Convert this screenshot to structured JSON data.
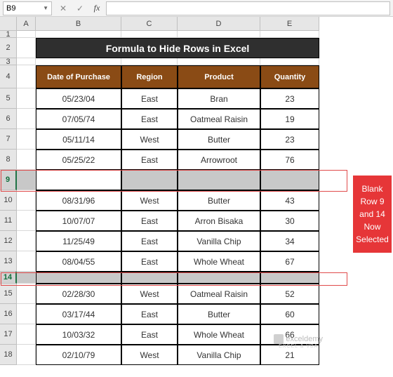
{
  "namebox": "B9",
  "columns": [
    "A",
    "B",
    "C",
    "D",
    "E"
  ],
  "rows": [
    "1",
    "2",
    "3",
    "4",
    "5",
    "6",
    "7",
    "8",
    "9",
    "10",
    "11",
    "12",
    "13",
    "14",
    "15",
    "16",
    "17",
    "18"
  ],
  "title": "Formula to Hide Rows in Excel",
  "headers": {
    "b": "Date of Purchase",
    "c": "Region",
    "d": "Product",
    "e": "Quantity"
  },
  "data": {
    "5": {
      "b": "05/23/04",
      "c": "East",
      "d": "Bran",
      "e": "23"
    },
    "6": {
      "b": "07/05/74",
      "c": "East",
      "d": "Oatmeal Raisin",
      "e": "19"
    },
    "7": {
      "b": "05/11/14",
      "c": "West",
      "d": "Butter",
      "e": "23"
    },
    "8": {
      "b": "05/25/22",
      "c": "East",
      "d": "Arrowroot",
      "e": "76"
    },
    "10": {
      "b": "08/31/96",
      "c": "West",
      "d": "Butter",
      "e": "43"
    },
    "11": {
      "b": "10/07/07",
      "c": "East",
      "d": "Arron Bisaka",
      "e": "30"
    },
    "12": {
      "b": "11/25/49",
      "c": "East",
      "d": "Vanilla Chip",
      "e": "34"
    },
    "13": {
      "b": "08/04/55",
      "c": "East",
      "d": "Whole Wheat",
      "e": "67"
    },
    "15": {
      "b": "02/28/30",
      "c": "West",
      "d": "Oatmeal Raisin",
      "e": "52"
    },
    "16": {
      "b": "03/17/44",
      "c": "East",
      "d": "Butter",
      "e": "60"
    },
    "17": {
      "b": "10/03/32",
      "c": "East",
      "d": "Whole Wheat",
      "e": "66"
    },
    "18": {
      "b": "02/10/79",
      "c": "West",
      "d": "Vanilla Chip",
      "e": "21"
    }
  },
  "callout": "Blank Row 9 and 14 Now Selected",
  "watermark": {
    "main": "exceldemy",
    "sub": "EXCEL & VBA"
  }
}
